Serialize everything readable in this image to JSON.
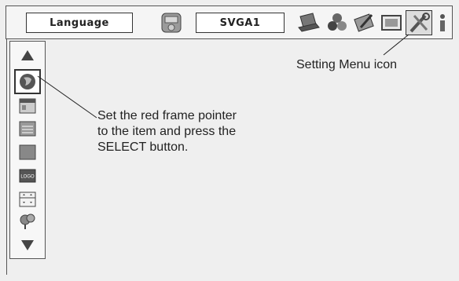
{
  "top_menu": {
    "language_label": "Language",
    "mode_label": "SVGA1",
    "icons": [
      "screen-menu-icon",
      "laptop-icon",
      "color-adjust-icon",
      "image-adjust-icon",
      "picture-frame-icon",
      "setting-menu-icon",
      "info-icon"
    ]
  },
  "sidebar": {
    "icons": [
      "up-arrow-icon",
      "globe-icon",
      "window-icon",
      "keyboard-icon",
      "background-icon",
      "logo-icon",
      "ceiling-icon",
      "signal-icon",
      "down-arrow-icon"
    ],
    "logo_text": "LOGO"
  },
  "annotations": {
    "setting_menu": "Setting Menu icon",
    "select_line1": "Set the red frame pointer",
    "select_line2": "to the item and press the",
    "select_line3": "SELECT button."
  }
}
